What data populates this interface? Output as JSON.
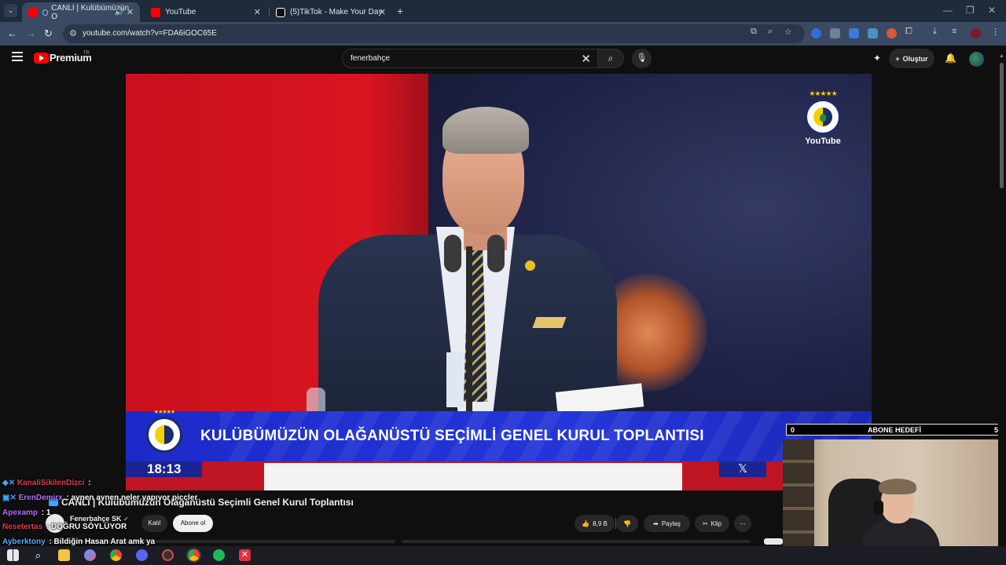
{
  "browser": {
    "tabs": [
      {
        "label": "CANLI | Kulübümüzün O",
        "active": true,
        "audio": true,
        "favicon": "youtube-icon"
      },
      {
        "label": "YouTube",
        "active": false,
        "favicon": "youtube-icon"
      },
      {
        "label": "(5)TikTok - Make Your Day",
        "active": false,
        "favicon": "tiktok-icon"
      }
    ],
    "close_glyph": "✕",
    "new_tab_glyph": "+",
    "url": "youtube.com/watch?v=FDA6iGOC65E"
  },
  "youtube": {
    "brand": "Premium",
    "region": "TR",
    "search_query": "fenerbahçe",
    "create_label": "Oluştur",
    "video": {
      "title": "CANLI | Kulübümüzün Olağanüstü Seçimli Genel Kurul Toplantısı",
      "overlay_headline": "KULÜBÜMÜZÜN OLAĞANÜSTÜ SEÇİMLİ GENEL KURUL TOPLANTISI",
      "overlay_time": "18:13",
      "watermark_text": "YouTube",
      "x_glyph": "𝕏"
    },
    "channel": {
      "name": "Fenerbahçe SK",
      "verified_glyph": "✓",
      "join_label": "Katıl",
      "subscribe_label": "Abone ol"
    },
    "actions": {
      "like_count": "8,9 B",
      "share_label": "Paylaş",
      "clip_label": "Klip",
      "more_glyph": "⋯"
    }
  },
  "stream_overlay": {
    "chat": [
      {
        "user": "KanaliSikilenDizci",
        "message": ":",
        "color": "#e23a4d"
      },
      {
        "user": "ErenDemirx",
        "message": ": aynen aynen neler yapıyor piccler",
        "color": "#b36bff"
      },
      {
        "user": "Apexamp",
        "message": ": 1",
        "color": "#b36bff"
      },
      {
        "user": "Nesetertas",
        "message": ": DOĞRU SÖYLÜYOR",
        "color": "#e23a4d"
      },
      {
        "user": "Ayberktony",
        "message": ": Bildiğin Hasan Arat amk ya",
        "color": "#5aa9ff"
      }
    ],
    "goal": {
      "current": "0",
      "label": "ABONE HEDEFİ",
      "target": "5"
    }
  }
}
